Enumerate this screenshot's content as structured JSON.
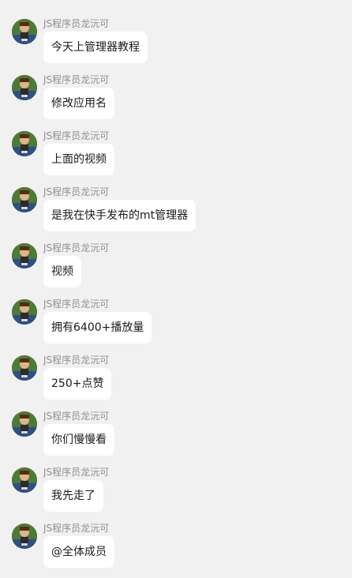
{
  "messages": [
    {
      "sender": "JS程序员龙沅可",
      "text": "今天上管理器教程"
    },
    {
      "sender": "JS程序员龙沅可",
      "text": "修改应用名"
    },
    {
      "sender": "JS程序员龙沅可",
      "text": "上面的视频"
    },
    {
      "sender": "JS程序员龙沅可",
      "text": "是我在快手发布的mt管理器"
    },
    {
      "sender": "JS程序员龙沅可",
      "text": "视频"
    },
    {
      "sender": "JS程序员龙沅可",
      "text": "拥有6400+播放量"
    },
    {
      "sender": "JS程序员龙沅可",
      "text": "250+点赞"
    },
    {
      "sender": "JS程序员龙沅可",
      "text": "你们慢慢看"
    },
    {
      "sender": "JS程序员龙沅可",
      "text": "我先走了"
    },
    {
      "sender": "JS程序员龙沅可",
      "text": "@全体成员"
    }
  ]
}
